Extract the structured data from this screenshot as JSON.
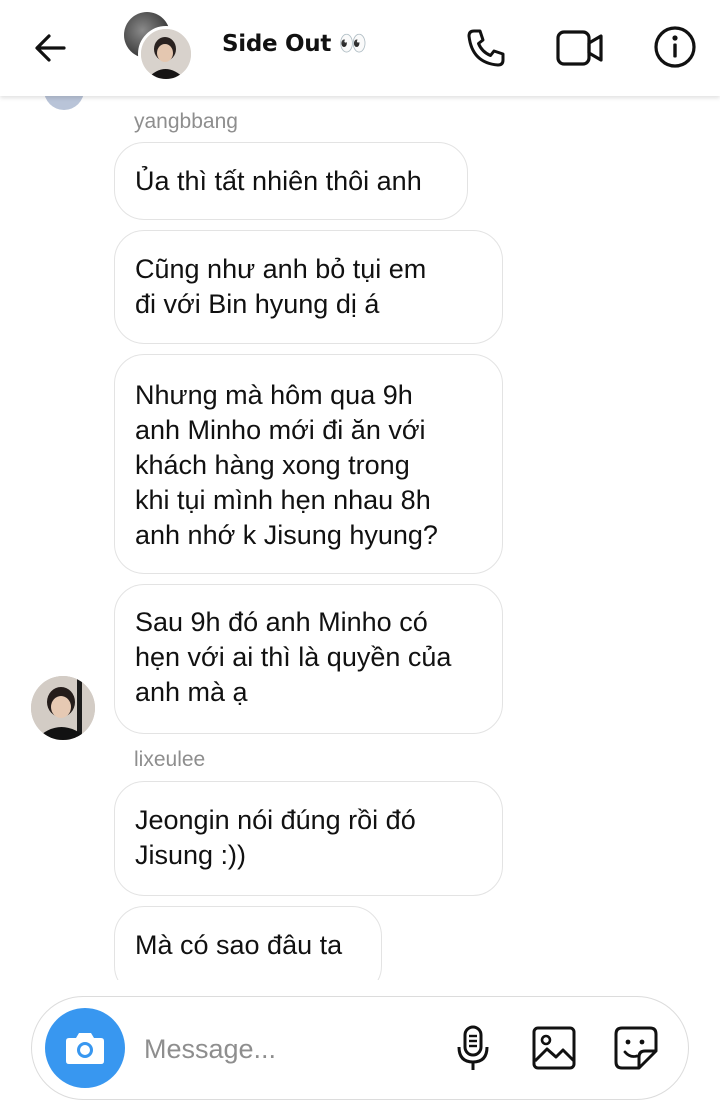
{
  "header": {
    "title": "Side Out 👀",
    "icons": [
      "back-arrow-icon",
      "phone-icon",
      "video-camera-icon",
      "info-icon"
    ]
  },
  "messages": {
    "sender_1": "yangbbang",
    "bubbles_1": [
      "Ủa thì tất nhiên thôi anh",
      "Cũng như anh bỏ tụi em\nđi với Bin hyung dị á",
      "Nhưng mà hôm qua 9h\nanh Minho mới đi ăn với\nkhách hàng xong trong\nkhi tụi mình hẹn nhau 8h\nanh nhớ k Jisung hyung?",
      "Sau 9h đó anh Minho có\nhẹn với ai thì là quyền của\nanh mà ạ"
    ],
    "sender_2": "lixeulee",
    "bubbles_2": [
      "Jeongin nói đúng rồi đó\nJisung :))",
      "Mà có sao đâu ta"
    ]
  },
  "composer": {
    "placeholder": "Message...",
    "accent": "#3897f0",
    "icons": [
      "camera-icon",
      "microphone-icon",
      "gallery-icon",
      "sticker-icon"
    ]
  }
}
